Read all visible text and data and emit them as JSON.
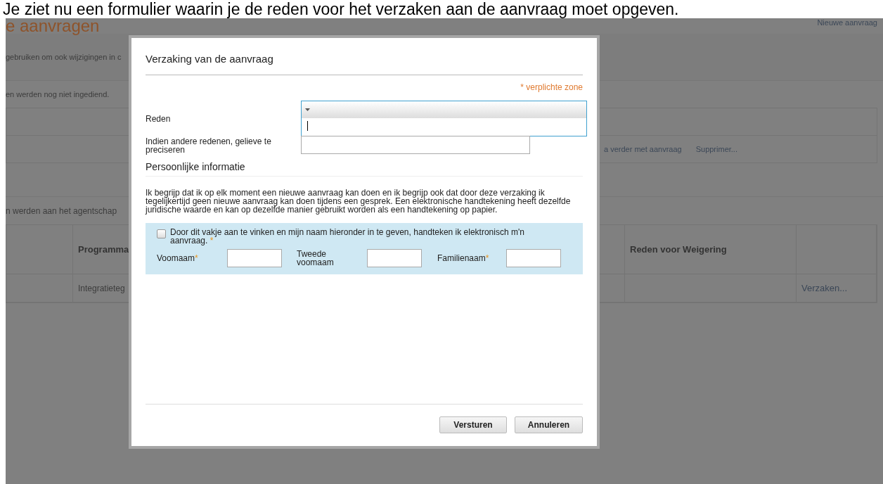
{
  "caption": "Je ziet nu een formulier waarin je de reden voor het verzaken aan de aanvraag moet opgeven.",
  "page": {
    "title": "e aanvragen",
    "new_request_link": "Nieuwe aanvraag",
    "intro": "gebruiken om ook wijzigingen in c",
    "drafts_note": "en werden nog niet ingediend.",
    "drafts_links": [
      "a verder met aanvraag",
      "Supprimer..."
    ],
    "submitted_note": "n werden aan het agentschap",
    "table": {
      "columns": [
        "Programma",
        "Reden voor Weigering"
      ],
      "rows": [
        {
          "program": "Integratieteg",
          "action": "Verzaken..."
        }
      ]
    }
  },
  "dialog": {
    "title": "Verzaking van de aanvraag",
    "required_note": "* verplichte zone",
    "required_mark": "*",
    "reason": {
      "label": "Reden",
      "expanded": true
    },
    "other_reason": {
      "label": "Indien andere redenen, gelieve te preciseren"
    },
    "section": "Persoonlijke informatie",
    "statement": "Ik begrijp dat ik op elk moment een nieuwe aanvraag kan doen en ik begrijp ook dat door deze verzaking ik tegelijkertijd geen nieuwe aanvraag kan doen tijdens een gesprek. Een elektronische handtekening heeft dezelfde juridische waarde en kan op dezelfde manier gebruikt worden als een handtekening op papier.",
    "signature": {
      "label": "Door dit vakje aan te vinken en mijn naam hieronder in te geven, handteken ik elektronisch m'n aanvraag.",
      "required": true,
      "checked": false,
      "names": [
        {
          "label": "Voomaam",
          "required": true
        },
        {
          "label": "Tweede voomaam",
          "required": false
        },
        {
          "label": "Familienaam",
          "required": true
        }
      ]
    },
    "buttons": [
      "Versturen",
      "Annuleren"
    ]
  }
}
